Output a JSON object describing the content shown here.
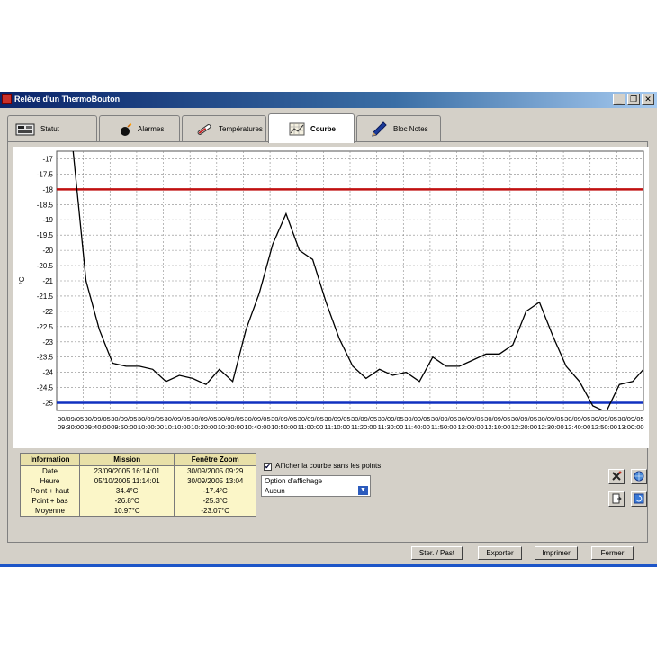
{
  "window": {
    "title": "Relève d'un ThermoBouton",
    "minimize": "_",
    "restore": "❐",
    "close": "✕"
  },
  "tabs": [
    {
      "label": "Statut",
      "icon": "status-panel-icon"
    },
    {
      "label": "Alarmes",
      "icon": "bomb-icon"
    },
    {
      "label": "Températures",
      "icon": "thermometer-icon"
    },
    {
      "label": "Courbe",
      "icon": "chart-grid-icon",
      "active": true
    },
    {
      "label": "Bloc Notes",
      "icon": "pen-icon"
    }
  ],
  "colors": {
    "alarm_high": "#c01010",
    "alarm_low": "#1030c0",
    "curve": "#000000",
    "grid": "#888888"
  },
  "chart_data": {
    "type": "line",
    "ylabel": "°C",
    "ylim": [
      -25.25,
      -16.75
    ],
    "y_ticks": [
      "-17",
      "-17.5",
      "-18",
      "-18.5",
      "-19",
      "-19.5",
      "-20",
      "-20.5",
      "-21",
      "-21.5",
      "-22",
      "-22.5",
      "-23",
      "-23.5",
      "-24",
      "-24.5",
      "-25"
    ],
    "x_tick_labels": [
      "30/09/05",
      "30/09/05",
      "30/09/05",
      "30/09/05",
      "30/09/05",
      "30/09/05",
      "30/09/05",
      "30/09/05",
      "30/09/05",
      "30/09/05",
      "30/09/05",
      "30/09/05",
      "30/09/05",
      "30/09/05",
      "30/09/05",
      "30/09/05",
      "30/09/05",
      "30/09/05",
      "30/09/05",
      "30/09/05",
      "30/09/05",
      "30/09/05",
      "09:30:00",
      "09:40:00",
      "09:50:00",
      "10:00:00",
      "10:10:00",
      "10:20:00",
      "10:30:00",
      "10:40:00",
      "10:50:00",
      "11:00:00",
      "11:10:00",
      "11:20:00",
      "11:30:00",
      "11:40:00",
      "11:50:00",
      "12:00:00",
      "12:10:00",
      "12:20:00",
      "12:30:00",
      "12:40:00",
      "12:50:00",
      "13:00:00"
    ],
    "x_ticks_top": [
      "30/09/05",
      "30/09/05",
      "30/09/05",
      "30/09/05",
      "30/09/05",
      "30/09/05",
      "30/09/05",
      "30/09/05",
      "30/09/05",
      "30/09/05",
      "30/09/05",
      "30/09/05",
      "30/09/05",
      "30/09/05",
      "30/09/05",
      "30/09/05",
      "30/09/05",
      "30/09/05",
      "30/09/05",
      "30/09/05",
      "30/09/05",
      "30/09/05"
    ],
    "x_ticks_bottom": [
      "09:30:00",
      "09:40:00",
      "09:50:00",
      "10:00:00",
      "10:10:00",
      "10:20:00",
      "10:30:00",
      "10:40:00",
      "10:50:00",
      "11:00:00",
      "11:10:00",
      "11:20:00",
      "11:30:00",
      "11:40:00",
      "11:50:00",
      "12:00:00",
      "12:10:00",
      "12:20:00",
      "12:30:00",
      "12:40:00",
      "12:50:00",
      "13:00:00"
    ],
    "alarm_high": -18,
    "alarm_low": -25,
    "series": [
      {
        "values": [
          -16.6,
          -21.0,
          -22.6,
          -23.7,
          -23.8,
          -23.8,
          -23.9,
          -24.3,
          -24.1,
          -24.2,
          -24.4,
          -23.9,
          -24.3,
          -22.6,
          -21.4,
          -19.8,
          -18.8,
          -20.0,
          -20.3,
          -21.7,
          -22.9,
          -23.8,
          -24.2,
          -23.9,
          -24.1,
          -24.0,
          -24.3,
          -23.5,
          -23.8,
          -23.8,
          -23.6,
          -23.4,
          -23.4,
          -23.1,
          -22.0,
          -21.7,
          -22.8,
          -23.8,
          -24.3,
          -25.1,
          -25.3,
          -24.4,
          -24.3,
          -23.8
        ],
        "x_positions": [
          1.0,
          1.5,
          2.0,
          2.5,
          3.0,
          3.5,
          4.0,
          4.5,
          5.0,
          5.5,
          6.0,
          6.5,
          7.0,
          7.5,
          8.0,
          8.5,
          9.0,
          9.5,
          10.0,
          10.5,
          11.0,
          11.5,
          12.0,
          12.5,
          13.0,
          13.5,
          14.0,
          14.5,
          15.0,
          15.5,
          16.0,
          16.5,
          17.0,
          17.5,
          18.0,
          18.5,
          19.0,
          19.5,
          20.0,
          20.5,
          21.0,
          21.5,
          22.0,
          22.5
        ]
      }
    ]
  },
  "info_table": {
    "headers": [
      "Information",
      "Mission",
      "Fenêtre Zoom"
    ],
    "rows": [
      [
        "Date",
        "23/09/2005 16:14:01",
        "30/09/2005 09:29"
      ],
      [
        "Heure",
        "05/10/2005 11:14:01",
        "30/09/2005 13:04"
      ],
      [
        "Point + haut",
        "34.4°C",
        "-17.4°C"
      ],
      [
        "Point + bas",
        "-26.8°C",
        "-25.3°C"
      ],
      [
        "Moyenne",
        "10.97°C",
        "-23.07°C"
      ]
    ]
  },
  "options": {
    "checkbox_label": "Afficher la courbe sans les points",
    "checkbox_checked": true,
    "display_label": "Option d'affichage",
    "display_value": "Aucun"
  },
  "side_buttons": [
    "tools-icon",
    "globe-icon",
    "export-file-icon",
    "refresh-icon"
  ],
  "footer_buttons": [
    "Ster. / Past",
    "Exporter",
    "Imprimer",
    "Fermer"
  ]
}
